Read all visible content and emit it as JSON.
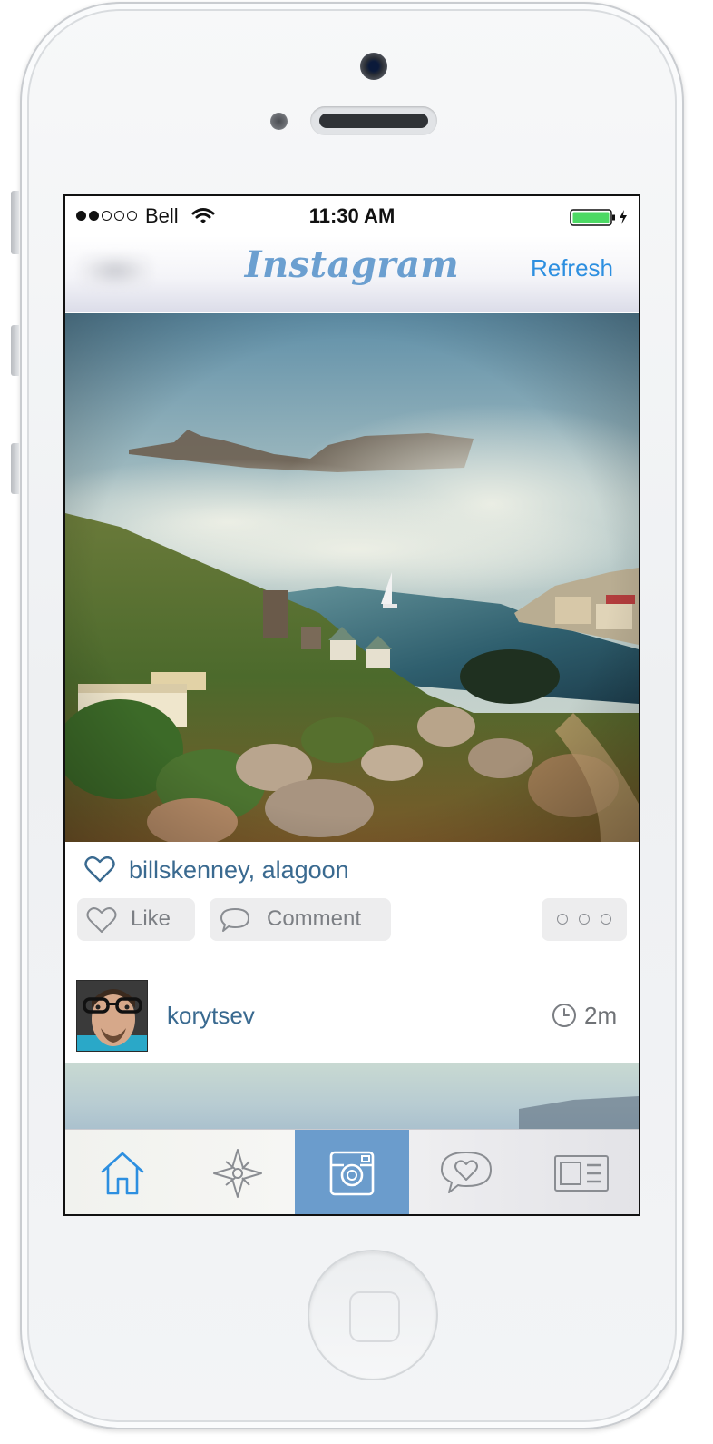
{
  "status_bar": {
    "carrier": "Bell",
    "time": "11:30 AM",
    "signal_bars_filled": 2,
    "signal_bars_total": 5,
    "battery_charging": true
  },
  "nav_bar": {
    "title": "Instagram",
    "refresh_label": "Refresh",
    "title_color": "#6b9fd0",
    "accent_color": "#2d8fe0"
  },
  "post": {
    "likes_text": "billskenney, alagoon",
    "like_label": "Like",
    "comment_label": "Comment"
  },
  "next_post": {
    "username": "korytsev",
    "time_ago": "2m"
  },
  "tab_bar": {
    "tabs": [
      {
        "icon": "home-icon",
        "active": true
      },
      {
        "icon": "explore-compass-icon",
        "active": false
      },
      {
        "icon": "camera-icon",
        "active": false,
        "highlighted": true
      },
      {
        "icon": "activity-heart-bubble-icon",
        "active": false
      },
      {
        "icon": "profile-card-icon",
        "active": false
      }
    ],
    "active_color": "#2d8fe0",
    "highlight_color": "#6b9ccc"
  }
}
